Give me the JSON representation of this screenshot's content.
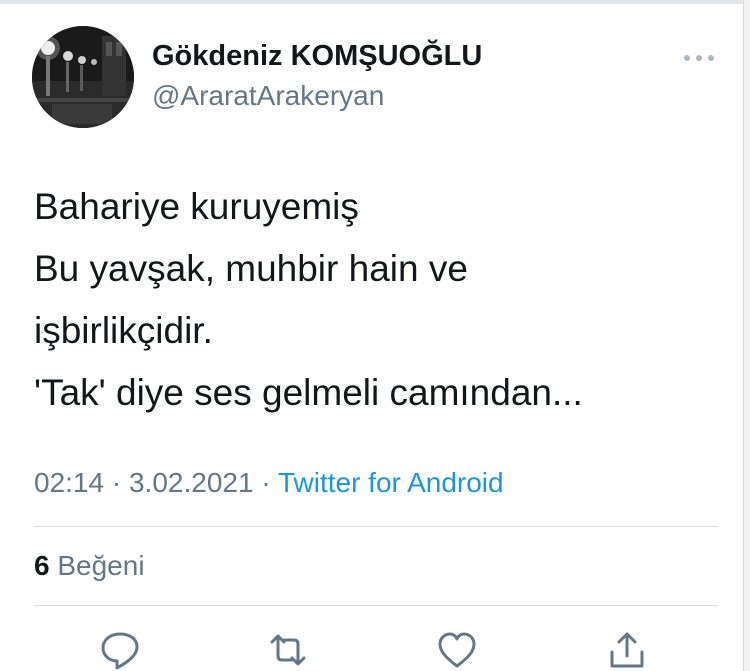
{
  "tweet": {
    "author": {
      "display_name": "Gökdeniz KOMŞUOĞLU",
      "username": "@AraratArakeryan"
    },
    "text_lines": [
      "Bahariye kuruyemiş",
      "Bu yavşak, muhbir hain ve",
      "işbirlikçidir.",
      "'Tak' diye ses gelmeli camından..."
    ],
    "time": "02:14",
    "separator": "·",
    "date": "3.02.2021",
    "source": "Twitter for Android",
    "likes": {
      "count": "6",
      "label": "Beğeni"
    }
  },
  "icons": {
    "more": "more-horizontal-icon",
    "reply": "reply-icon",
    "retweet": "retweet-icon",
    "like": "heart-icon",
    "share": "share-icon"
  },
  "colors": {
    "text": "#14171a",
    "secondary": "#657786",
    "link": "#1b95e0",
    "divider": "#d9dde0"
  }
}
